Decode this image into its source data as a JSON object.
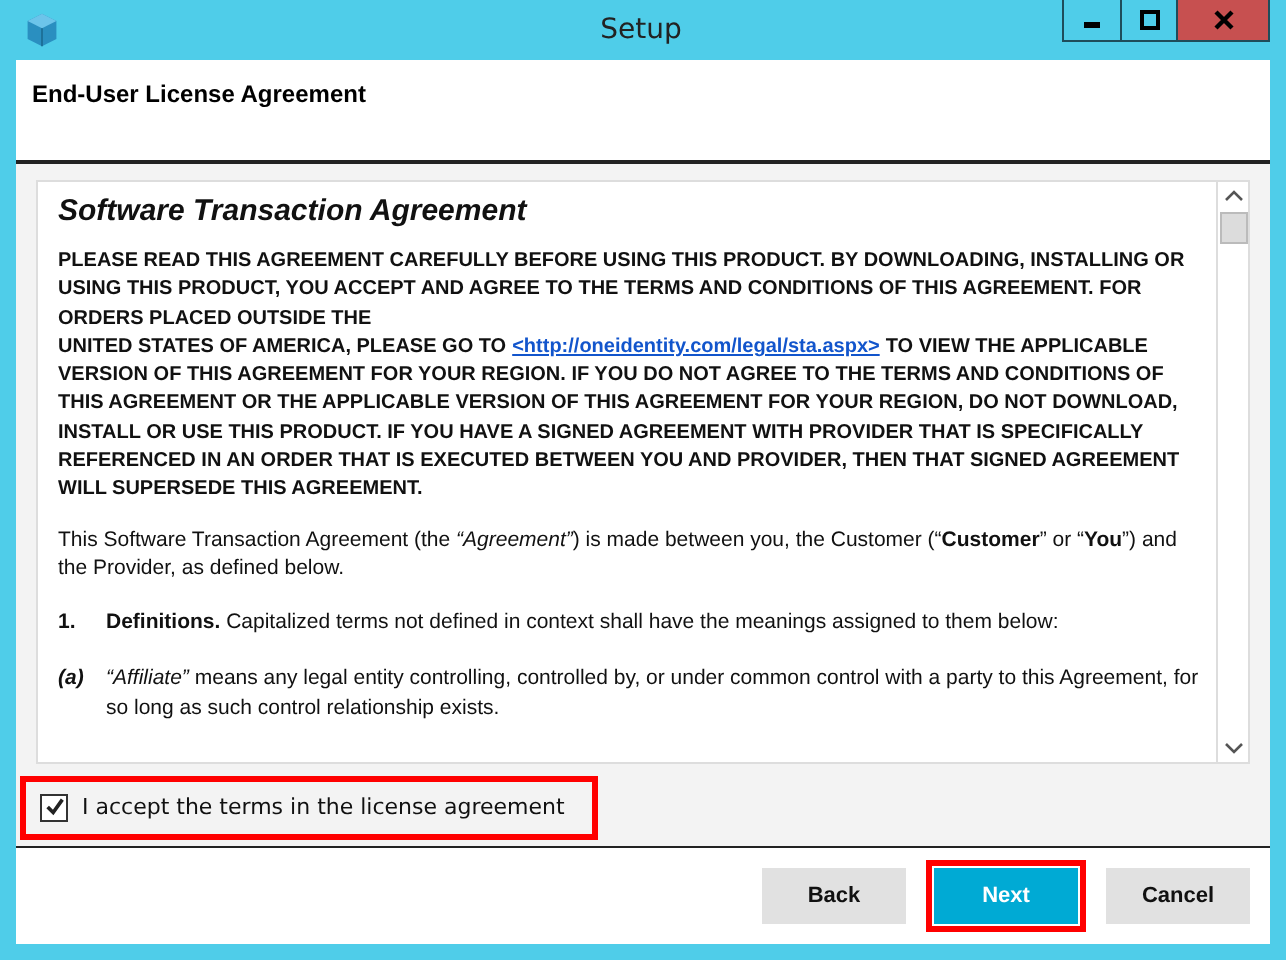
{
  "window": {
    "title": "Setup"
  },
  "header": {
    "title": "End-User License Agreement"
  },
  "license": {
    "title": "Software Transaction Agreement",
    "notice_before": "PLEASE READ THIS AGREEMENT CAREFULLY BEFORE USING THIS PRODUCT. BY DOWNLOADING, INSTALLING OR USING THIS PRODUCT, YOU ACCEPT AND AGREE TO THE TERMS AND CONDITIONS OF THIS AGREEMENT. FOR ORDERS PLACED OUTSIDE THE",
    "notice_lead": "UNITED STATES OF AMERICA, PLEASE GO TO",
    "notice_link": "<http://oneidentity.com/legal/sta.aspx>",
    "notice_after": "TO VIEW THE APPLICABLE VERSION OF THIS AGREEMENT FOR YOUR REGION. IF YOU DO NOT AGREE TO THE TERMS AND CONDITIONS OF THIS AGREEMENT OR THE APPLICABLE VERSION OF THIS AGREEMENT FOR YOUR REGION, DO NOT DOWNLOAD, INSTALL OR USE THIS PRODUCT. IF YOU HAVE A SIGNED AGREEMENT WITH PROVIDER THAT IS SPECIFICALLY REFERENCED IN AN ORDER THAT IS EXECUTED BETWEEN YOU AND PROVIDER, THEN THAT SIGNED AGREEMENT WILL SUPERSEDE THIS AGREEMENT.",
    "intro": "This Software Transaction Agreement (the *“Agreement”*) is made between you, the Customer (“**Customer**” or “**You**”) and the Provider, as defined below.",
    "clauses": [
      {
        "kind": "section",
        "number": "1.",
        "text": "**Definitions.** Capitalized terms not defined in context shall have the meanings assigned to them below:"
      },
      {
        "kind": "subsection",
        "number": "(a)",
        "text": "*“Affiliate”* means any legal entity controlling, controlled by, or under common control with a party to this Agreement, for so long as such control relationship exists."
      }
    ]
  },
  "accept": {
    "label": "I accept the terms in the license agreement",
    "checked": true,
    "highlighted": true
  },
  "buttons": [
    {
      "label": "Back",
      "primary": false,
      "highlighted": false
    },
    {
      "label": "Next",
      "primary": true,
      "highlighted": true
    },
    {
      "label": "Cancel",
      "primary": false,
      "highlighted": false
    }
  ]
}
